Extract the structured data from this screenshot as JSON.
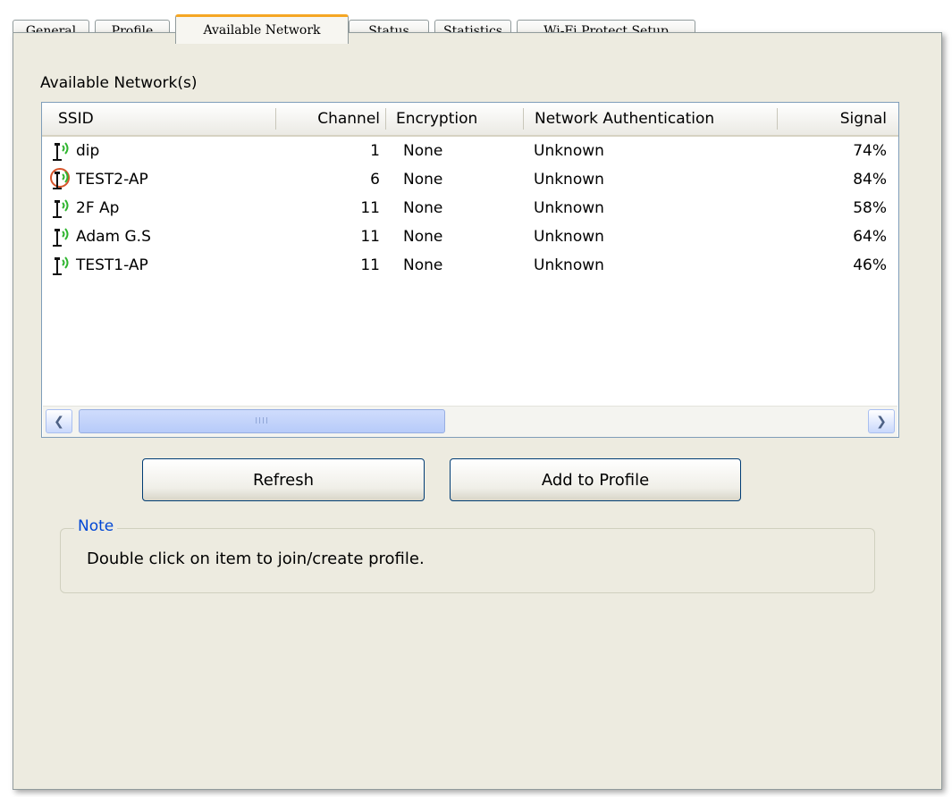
{
  "tabs": [
    {
      "label": "General"
    },
    {
      "label": "Profile"
    },
    {
      "label": "Available Network",
      "active": true
    },
    {
      "label": "Status"
    },
    {
      "label": "Statistics"
    },
    {
      "label": "Wi-Fi Protect Setup"
    }
  ],
  "available_networks": {
    "label": "Available Network(s)",
    "columns": {
      "ssid": "SSID",
      "channel": "Channel",
      "encryption": "Encryption",
      "authentication": "Network Authentication",
      "signal": "Signal"
    },
    "rows": [
      {
        "ssid": "dip",
        "channel": "1",
        "encryption": "None",
        "authentication": "Unknown",
        "signal": "74%",
        "icon": "wireless-ap-icon"
      },
      {
        "ssid": "TEST2-AP",
        "channel": "6",
        "encryption": "None",
        "authentication": "Unknown",
        "signal": "84%",
        "icon": "wireless-ap-connected-icon"
      },
      {
        "ssid": "2F Ap",
        "channel": "11",
        "encryption": "None",
        "authentication": "Unknown",
        "signal": "58%",
        "icon": "wireless-ap-icon"
      },
      {
        "ssid": "Adam G.S",
        "channel": "11",
        "encryption": "None",
        "authentication": "Unknown",
        "signal": "64%",
        "icon": "wireless-ap-icon"
      },
      {
        "ssid": "TEST1-AP",
        "channel": "11",
        "encryption": "None",
        "authentication": "Unknown",
        "signal": "46%",
        "icon": "wireless-ap-icon"
      }
    ]
  },
  "buttons": {
    "refresh": "Refresh",
    "add_to_profile": "Add to Profile"
  },
  "note": {
    "title": "Note",
    "text": "Double click on item to join/create profile."
  },
  "colors": {
    "active_tab_accent": "#f5a623",
    "panel_background": "#edebe0",
    "note_title": "#0046d5",
    "signal_waves": "#2fb52f",
    "connected_ring": "#d6542a"
  }
}
